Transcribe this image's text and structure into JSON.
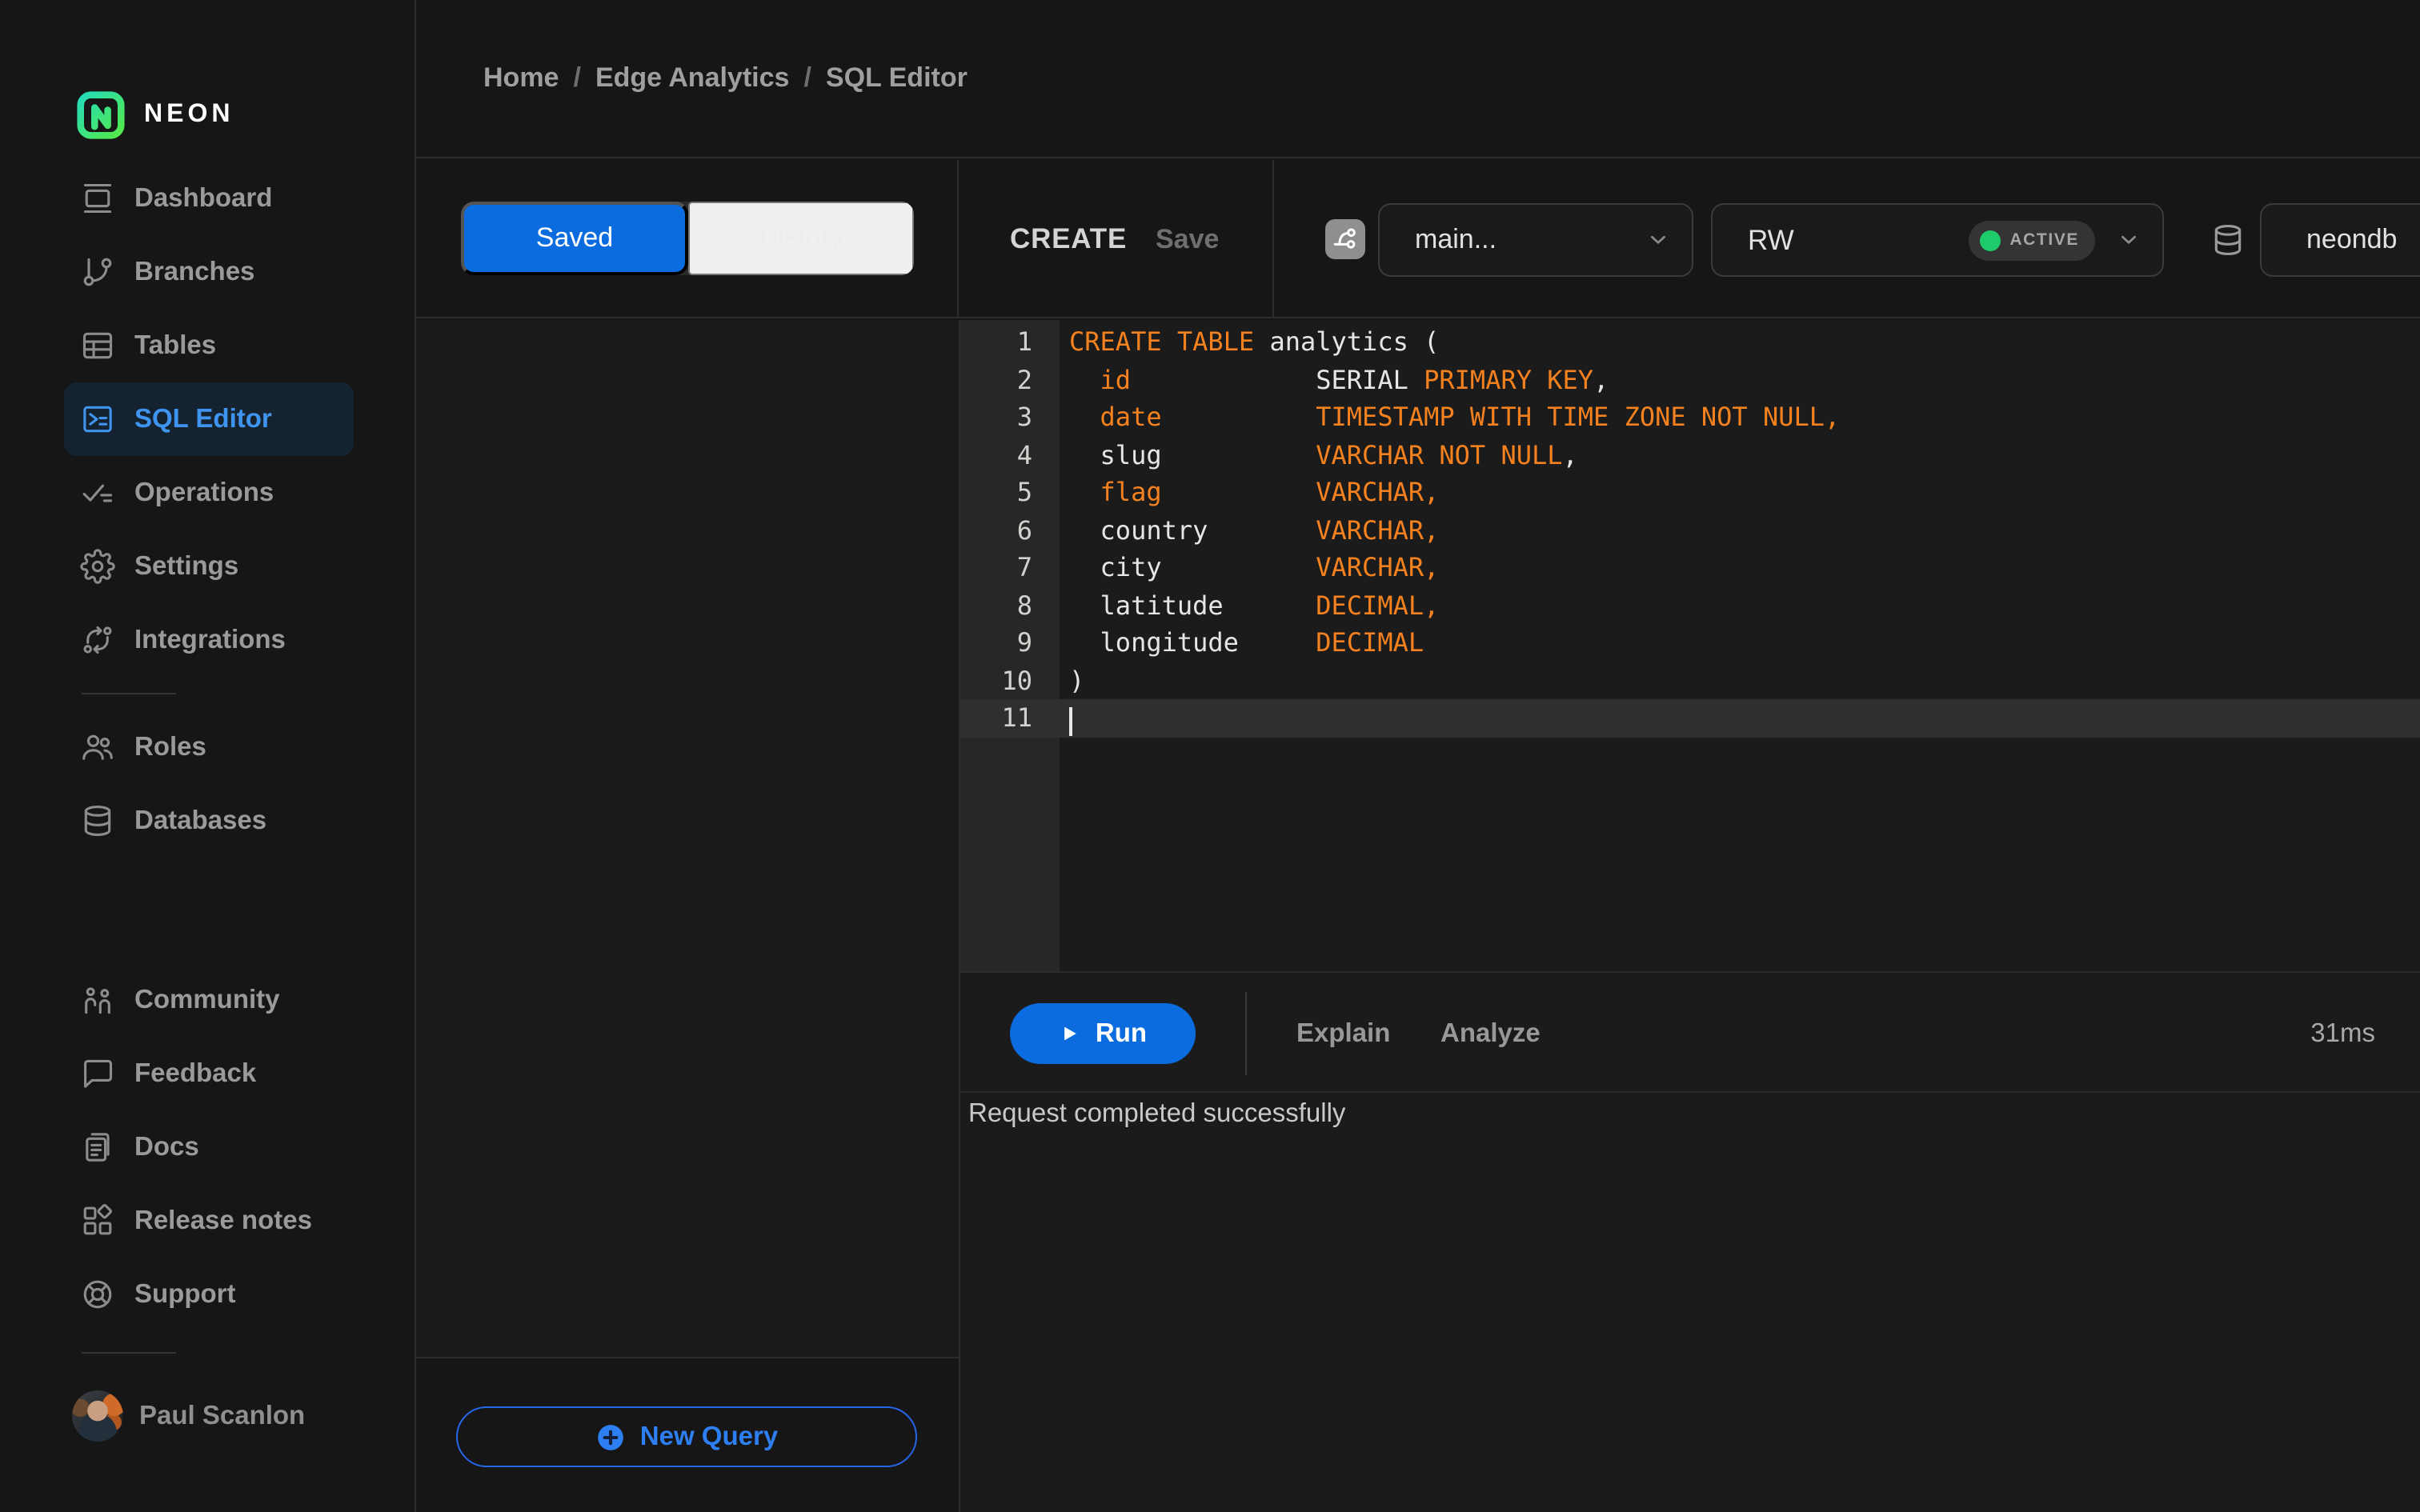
{
  "colors": {
    "accent": "#0a6cdf",
    "link": "#2e7ff2",
    "nav_active": "#3f94f0",
    "nav_active_bg": "#152330",
    "keyword": "#f5821f",
    "code_plain": "#e6e6e6",
    "success": "#1ecb6b"
  },
  "brand": {
    "name": "NEON"
  },
  "breadcrumb": {
    "separator": "/",
    "items": [
      "Home",
      "Edge Analytics",
      "SQL Editor"
    ]
  },
  "sidebar": {
    "primary": [
      {
        "label": "Dashboard",
        "icon": "dashboard-icon",
        "active": false
      },
      {
        "label": "Branches",
        "icon": "git-branch-icon",
        "active": false
      },
      {
        "label": "Tables",
        "icon": "table-icon",
        "active": false
      },
      {
        "label": "SQL Editor",
        "icon": "terminal-icon",
        "active": true
      },
      {
        "label": "Operations",
        "icon": "checklist-icon",
        "active": false
      },
      {
        "label": "Settings",
        "icon": "gear-icon",
        "active": false
      },
      {
        "label": "Integrations",
        "icon": "integrations-icon",
        "active": false
      }
    ],
    "secondary": [
      {
        "label": "Roles",
        "icon": "roles-icon",
        "active": false
      },
      {
        "label": "Databases",
        "icon": "database-icon",
        "active": false
      }
    ],
    "tertiary": [
      {
        "label": "Community",
        "icon": "community-icon",
        "active": false
      },
      {
        "label": "Feedback",
        "icon": "feedback-icon",
        "active": false
      },
      {
        "label": "Docs",
        "icon": "docs-icon",
        "active": false
      },
      {
        "label": "Release notes",
        "icon": "release-notes-icon",
        "active": false
      },
      {
        "label": "Support",
        "icon": "support-icon",
        "active": false
      }
    ],
    "user": {
      "name": "Paul Scanlon"
    }
  },
  "query_panel": {
    "tabs": [
      {
        "label": "Saved",
        "active": true
      },
      {
        "label": "History",
        "active": false
      }
    ],
    "new_query_label": "New Query"
  },
  "editor": {
    "title": "CREATE",
    "save_label": "Save",
    "branch_selector": {
      "value": "main..."
    },
    "compute_selector": {
      "value": "RW",
      "status_badge": "ACTIVE"
    },
    "database_selector": {
      "value": "neondb"
    },
    "actions": {
      "run_label": "Run",
      "explain_label": "Explain",
      "analyze_label": "Analyze",
      "duration": "31ms"
    },
    "status_message": "Request completed successfully",
    "code": {
      "lines": [
        {
          "n": 1,
          "seg": [
            {
              "t": "CREATE TABLE",
              "c": "k"
            },
            {
              "t": " analytics (",
              "c": "p"
            }
          ]
        },
        {
          "n": 2,
          "seg": [
            {
              "t": "  ",
              "c": "p"
            },
            {
              "t": "id",
              "c": "k"
            },
            {
              "t": "            SERIAL ",
              "c": "p"
            },
            {
              "t": "PRIMARY KEY",
              "c": "k"
            },
            {
              "t": ",",
              "c": "p"
            }
          ]
        },
        {
          "n": 3,
          "seg": [
            {
              "t": "  ",
              "c": "p"
            },
            {
              "t": "date",
              "c": "k"
            },
            {
              "t": "          ",
              "c": "p"
            },
            {
              "t": "TIMESTAMP WITH TIME ZONE NOT NULL,",
              "c": "k"
            }
          ]
        },
        {
          "n": 4,
          "seg": [
            {
              "t": "  slug          ",
              "c": "p"
            },
            {
              "t": "VARCHAR NOT NULL",
              "c": "k"
            },
            {
              "t": ",",
              "c": "p"
            }
          ]
        },
        {
          "n": 5,
          "seg": [
            {
              "t": "  ",
              "c": "p"
            },
            {
              "t": "flag",
              "c": "k"
            },
            {
              "t": "          ",
              "c": "p"
            },
            {
              "t": "VARCHAR,",
              "c": "k"
            }
          ]
        },
        {
          "n": 6,
          "seg": [
            {
              "t": "  country       ",
              "c": "p"
            },
            {
              "t": "VARCHAR,",
              "c": "k"
            }
          ]
        },
        {
          "n": 7,
          "seg": [
            {
              "t": "  city          ",
              "c": "p"
            },
            {
              "t": "VARCHAR,",
              "c": "k"
            }
          ]
        },
        {
          "n": 8,
          "seg": [
            {
              "t": "  latitude      ",
              "c": "p"
            },
            {
              "t": "DECIMAL,",
              "c": "k"
            }
          ]
        },
        {
          "n": 9,
          "seg": [
            {
              "t": "  longitude     ",
              "c": "p"
            },
            {
              "t": "DECIMAL",
              "c": "k"
            }
          ]
        },
        {
          "n": 10,
          "seg": [
            {
              "t": ")",
              "c": "p"
            }
          ]
        },
        {
          "n": 11,
          "seg": [],
          "cursor": true,
          "active": true
        }
      ]
    }
  }
}
